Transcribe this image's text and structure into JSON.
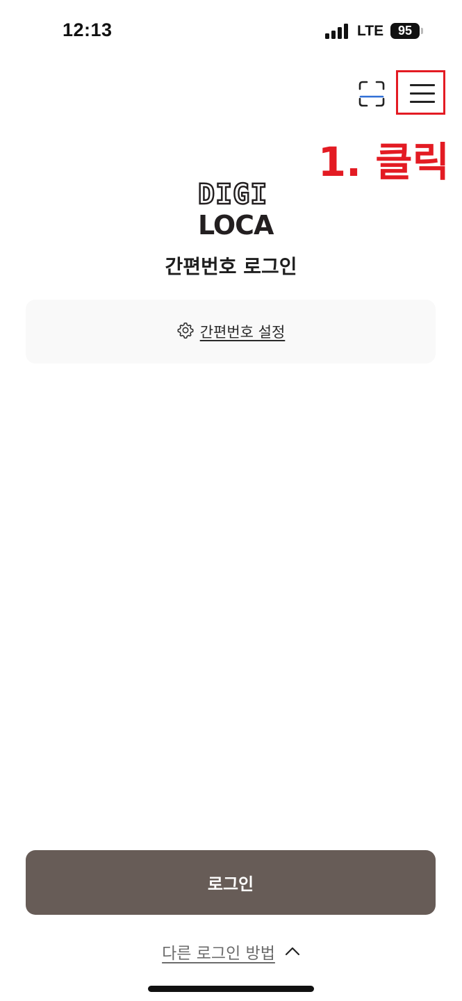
{
  "status_bar": {
    "time": "12:13",
    "network": "LTE",
    "battery": "95"
  },
  "header": {
    "scan_icon": "qr-scan-icon",
    "menu_icon": "hamburger-menu-icon"
  },
  "annotation": {
    "text": "1. 클릭",
    "color": "#e31b23"
  },
  "logo": {
    "line1": "DIGI",
    "line2": "LOCA"
  },
  "page": {
    "title": "간편번호 로그인"
  },
  "settings": {
    "icon": "gear-icon",
    "label": "간편번호 설정"
  },
  "login_button": {
    "label": "로그인",
    "color": "#675c57"
  },
  "other_login": {
    "label": "다른 로그인 방법",
    "icon": "chevron-up-icon"
  }
}
